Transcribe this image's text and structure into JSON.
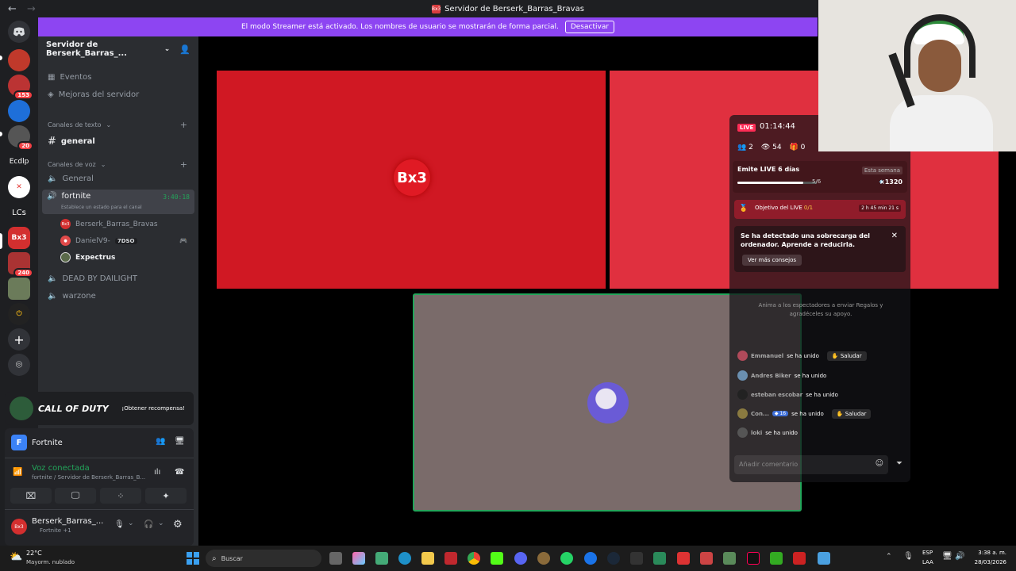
{
  "titlebar": {
    "back": "←",
    "forward": "→",
    "title": "Servidor de Berserk_Barras_Bravas",
    "icon_text": "Bx3"
  },
  "streamer": {
    "message": "El modo Streamer está activado. Los nombres de usuario se mostrarán de forma parcial.",
    "deactivate": "Desactivar"
  },
  "guilds": [
    {
      "kind": "discord",
      "text": ""
    },
    {
      "text": "",
      "color": "#c0392b"
    },
    {
      "text": "",
      "color": "#b33",
      "badge": "153"
    },
    {
      "text": "",
      "color": "#1e6fd9"
    },
    {
      "text": "",
      "color": "#555",
      "badge": "20"
    },
    {
      "text": "Ecdlp"
    },
    {
      "text": "",
      "color": "#e53935"
    },
    {
      "text": "LCs"
    },
    {
      "text": "Bx3",
      "color": "#d32f2f"
    },
    {
      "text": "",
      "color": "#a33",
      "badge": "240"
    },
    {
      "text": "",
      "color": "#6b7b5a"
    },
    {
      "text": "",
      "color": "#222"
    },
    {
      "text": "+"
    },
    {
      "text": "⌾"
    }
  ],
  "channels": {
    "server_name": "Servidor de Berserk_Barras_...",
    "events": "Eventos",
    "boosts": "Mejoras del servidor",
    "text_category": "Canales de texto",
    "text_channels": [
      "general"
    ],
    "voice_category": "Canales de voz",
    "voice_channels": [
      "General",
      "fortnite",
      "DEAD BY DAILIGHT",
      "warzone"
    ],
    "active_channel_status": "Establece un estado para el canal",
    "active_channel_timer": "3:40:18",
    "voice_users": [
      {
        "name": "Berserk_Barras_Bravas",
        "tag": ""
      },
      {
        "name": "DanielV9-",
        "tag": "7DSO"
      },
      {
        "name": "Expectrus",
        "tag": ""
      }
    ]
  },
  "promo": {
    "game": "CALL OF DUTY",
    "cta": "¡Obtener recompensa!"
  },
  "activity": {
    "name": "Fortnite"
  },
  "voice": {
    "status": "Voz conectada",
    "location": "fortnite / Servidor de Berserk_Barras_B..."
  },
  "user": {
    "name": "Berserk_Barras_...",
    "activity": "Fortnite +1"
  },
  "tiles": {
    "logo_text": "Bx3"
  },
  "live": {
    "badge": "LIVE",
    "timer": "01:14:44",
    "followers": "2",
    "viewers": "54",
    "gifts": "0",
    "streak_title": "Emite LIVE 6 días",
    "streak_week": "Esta semana",
    "streak_progress": "5/6",
    "streak_value": 0.83,
    "coins": "×1320",
    "goal_label": "Objetivo del LIVE",
    "goal_progress": "0/1",
    "goal_time": "2 h 45 min 21 s",
    "warning": "Se ha detectado una sobrecarga del ordenador. Aprende a reducirla.",
    "warning_btn": "Ver más consejos",
    "gift_hint": "Anima a los espectadores a enviar Regalos y agradéceles su apoyo.",
    "joins": [
      {
        "name": "Emmanuel",
        "action": "se ha unido",
        "button": "Saludar",
        "color": "#b04a5a"
      },
      {
        "name": "Andres Biker",
        "action": "se ha unido",
        "button": "",
        "color": "#6a8fb0"
      },
      {
        "name": "esteban escobar",
        "action": "se ha unido",
        "button": "",
        "color": "#222"
      },
      {
        "name": "Con...",
        "action": "se ha unido",
        "button": "Saludar",
        "color": "#8a7a40",
        "level": "16"
      },
      {
        "name": "loki",
        "action": "se ha unido",
        "button": "",
        "color": "#555"
      }
    ],
    "comment_placeholder": "Añadir comentario"
  },
  "taskbar": {
    "temp": "22°C",
    "weather": "Mayorm. nublado",
    "search": "Buscar",
    "lang": "ESP",
    "lang2": "LAA",
    "time": "3:38 a. m.",
    "date": "28/03/2026"
  }
}
